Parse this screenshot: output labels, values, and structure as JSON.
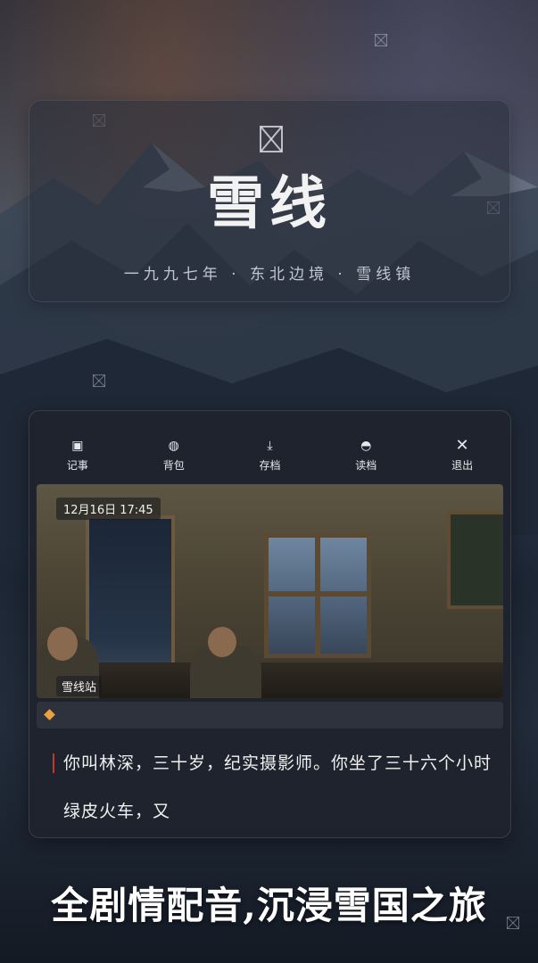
{
  "title_panel": {
    "title": "雪线",
    "subtitle": "一九九七年 · 东北边境 · 雪线镇"
  },
  "toolbar": {
    "items": [
      {
        "label": "记事",
        "icon": "notebook-icon"
      },
      {
        "label": "背包",
        "icon": "backpack-icon"
      },
      {
        "label": "存档",
        "icon": "save-download-icon"
      },
      {
        "label": "读档",
        "icon": "load-icon"
      },
      {
        "label": "退出",
        "icon": "close-icon"
      }
    ]
  },
  "scene": {
    "timestamp": "12月16日 17:45",
    "location": "雪线站"
  },
  "dialogue": {
    "text": "你叫林深，三十岁，纪实摄影师。你坐了三十六个小时绿皮火车，又"
  },
  "tagline": "全剧情配音,沉浸雪国之旅",
  "colors": {
    "accent_diamond": "#e8a045",
    "dialogue_marker": "#c0392b"
  }
}
